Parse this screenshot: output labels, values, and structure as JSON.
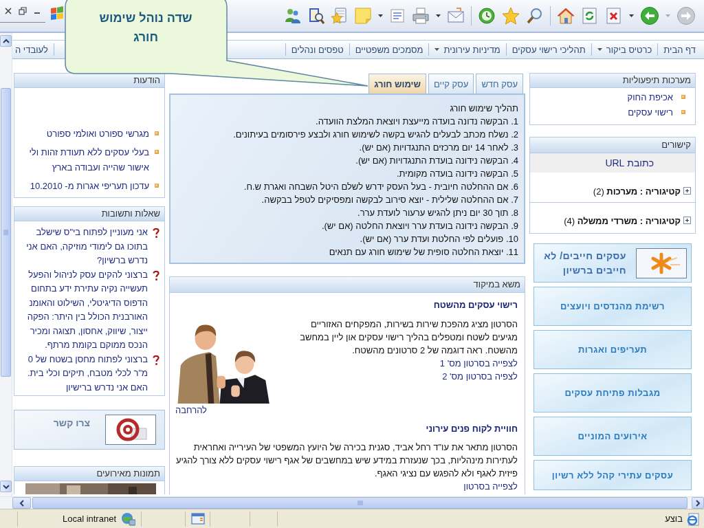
{
  "callout": {
    "text": "שדה נוהל שימוש חורג"
  },
  "nav": {
    "items": [
      {
        "label": "דף הבית",
        "dropdown": false
      },
      {
        "label": "כרטיס ביקור",
        "dropdown": true
      },
      {
        "label": "תהליכי רישוי עסקים",
        "dropdown": false
      },
      {
        "label": "מדיניות עירונית",
        "dropdown": true
      },
      {
        "label": "מסמכים משפטיים",
        "dropdown": false
      },
      {
        "label": "טפסים ונהלים",
        "dropdown": false
      },
      {
        "label": "לעובדי ה",
        "dropdown": false
      }
    ]
  },
  "notices": {
    "title": "הודעות",
    "items": [
      "מגרשי ספורט ואולמי ספורט",
      "בעלי עסקים ללא תעודת זהות ולי אישור שהייה ועבודה בארץ",
      "עדכון תעריפי אגרות מ- 10.2010"
    ]
  },
  "faq": {
    "title": "שאלות ותשובות",
    "items": [
      "אני מעוניין לפתוח בי\"ס שישלב בתוכו גם לימודי מוזיקה, האם אני נדרש ברשיון?",
      "ברצוני להקים עסק לניהול והפעל תעשייה נקיה עתירת ידע בתחום הדפוס הדיגיטלי, השילוט והאומנ האורבנית הכולל בין היתר: הפקה ייצור, שיווק, אחסון, תצוגה ומכיר הנכס ממוקם בקומת מרתף.",
      "ברצוני לפתוח מחסן בשטח של 0 מ\"ר לכלי מטבח, תיקים וכלי בית. האם אני נדרש ברישיון"
    ]
  },
  "contact": {
    "label": "צרו קשר"
  },
  "event_photos": {
    "title": "תמונות מאירועים"
  },
  "tabs": [
    {
      "label": "עסק חדש",
      "selected": false
    },
    {
      "label": "עסק קיים",
      "selected": false
    },
    {
      "label": "שימוש חורג",
      "selected": true
    }
  ],
  "process": {
    "title": "תהליך שימוש חורג",
    "steps": [
      "1. הבקשה נדונה בועדה מייעצת ויוצאת המלצת הוועדה.",
      "2. נשלח מכתב לבעלים להגיש בקשה לשימוש חורג ולבצע פירסומים בעיתונים.",
      "3. לאחר 14 יום מרכזים התנגדויות (אם יש).",
      "4. הבקשה נידונה בועדת התנגדויות (אם יש).",
      "5. הבקשה נידונה בועדה מקומית.",
      "6. אם ההחלטה חיובית - בעל העסק ידרש לשלם היטל השבחה ואגרת ש.ח.",
      "7. אם ההחלטה שלילית - יוצא סירוב לבקשה ומפסיקים לטפל בבקשה.",
      "8. תוך 30 יום ניתן להגיש ערעור לועדת ערר.",
      "9. הבקשה נידונה בועדת ערר ויוצאת החלטה (אם יש).",
      "10. פועלים לפי החלטת ועדת ערר (אם יש).",
      "11. יוצאת החלטה סופית של שימוש חורג עם תנאים"
    ]
  },
  "focus": {
    "title": "משא במיקוד",
    "articles": [
      {
        "heading": "רישוי עסקים מהשטח",
        "body": "הסרטון מציג מהפכת שירות בשירות, המפקחים האזוריים מגיעים לשטח ומטפלים בהליך רישוי עסקים און ליין במחשב מהשטח. ראה דוגמה של 2 סרטונים מהשטח.",
        "links": [
          "לצפייה בסרטון מס' 1",
          "לצפיה בסרטון מס' 2"
        ],
        "image": {
          "kind": "picture"
        },
        "more": "להרחבה"
      },
      {
        "heading": "חוויית לקוח פנים עירוני",
        "body": "הסרטון מתאר את עו\"ד רחל אביד, סגנית בכירה של היועץ המשפטי של העירייה ואחראית לעתירות מינהליות, בכך שנעזרת במידע שיש במחשבים של אגף רישוי עסקים ללא צורך להגיע פיזית לאגף ולא להפגש עם נציגי האגף.",
        "links": [
          "לצפייה בסרטון"
        ]
      }
    ]
  },
  "operational_systems": {
    "title": "מערכות תיפעוליות",
    "links": [
      "אכיפת החוק",
      "רישוי עסקים"
    ]
  },
  "links_panel": {
    "title": "קישורים",
    "column": "כתובת URL",
    "categories": [
      {
        "label": "**קטיגוריה : מערכות** (2)",
        "expanded": false
      },
      {
        "label": "**קטיגוריה : משרדי ממשלה** (4)",
        "expanded": false
      }
    ]
  },
  "quick_buttons": [
    {
      "label": "עסקים חייבים/ לא חייבים ברשיון",
      "kind": "icon"
    },
    {
      "label": "רשימת מהנדסים ויועצים",
      "kind": "plain"
    },
    {
      "label": "תעריפים ואגרות",
      "kind": "plain"
    },
    {
      "label": "מגבלות פתיחת עסקים",
      "kind": "plain"
    },
    {
      "label": "אירועים המוניים",
      "kind": "plain"
    },
    {
      "label": "עסקים עתירי קהל ללא רשיון",
      "kind": "plain"
    }
  ],
  "status_bar": {
    "status": "בוצע",
    "zone": "Local intranet"
  }
}
